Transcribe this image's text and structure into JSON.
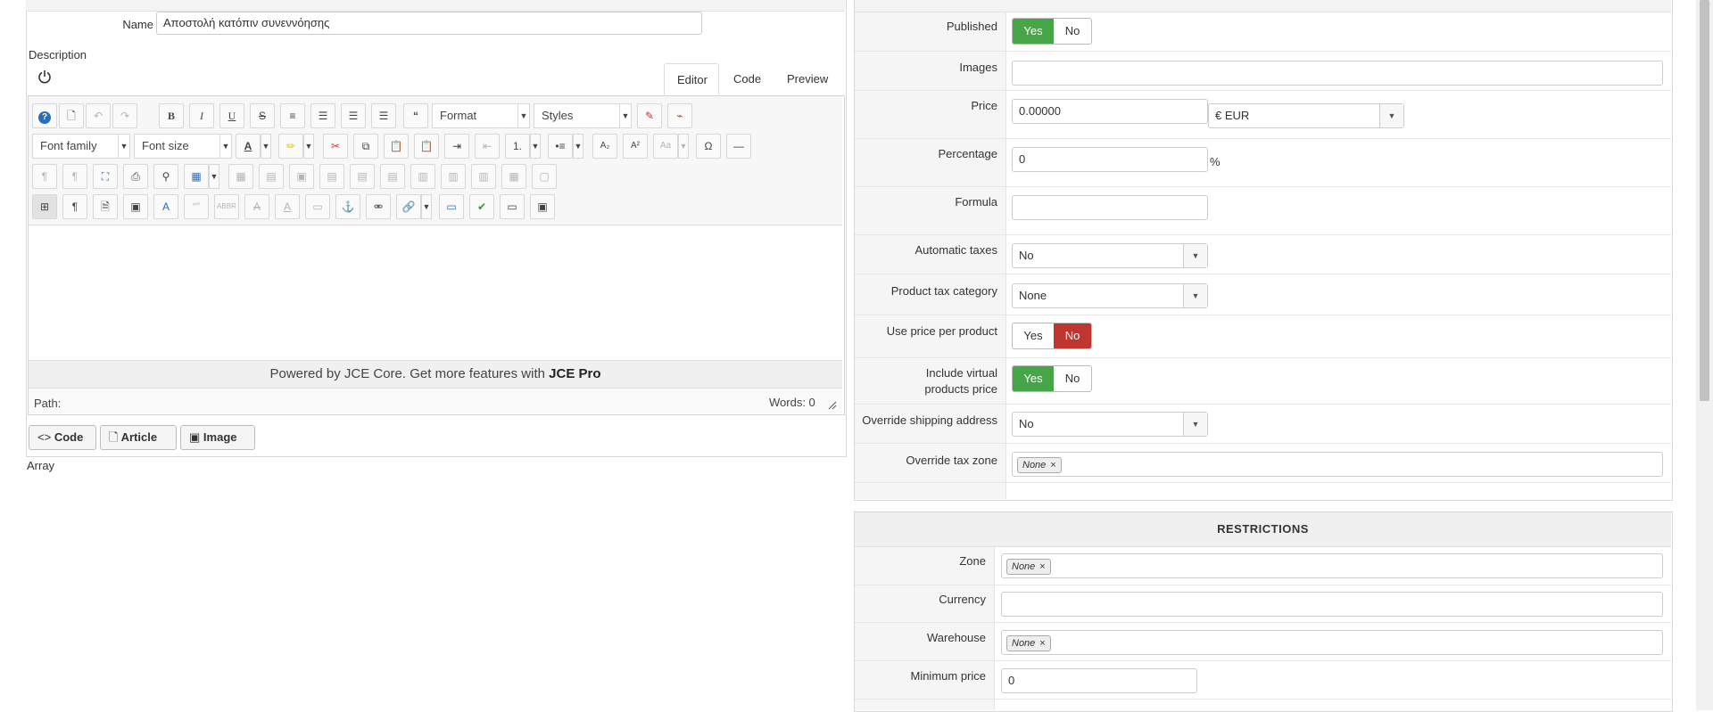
{
  "name_field": {
    "label": "Name",
    "value": "Αποστολή κατόπιν συνεννόησης"
  },
  "description": {
    "label": "Description",
    "tabs": [
      {
        "label": "Editor"
      },
      {
        "label": "Code"
      },
      {
        "label": "Preview"
      }
    ],
    "toolbar": {
      "format_label": "Format",
      "styles_label": "Styles",
      "font_family_label": "Font family",
      "font_size_label": "Font size"
    },
    "powered_by_text": "Powered by JCE Core. Get more features with ",
    "powered_by_strong": "JCE Pro",
    "path_label": "Path:",
    "words_label": "Words: 0",
    "buttons": [
      {
        "label": "Code"
      },
      {
        "label": "Article"
      },
      {
        "label": "Image"
      }
    ]
  },
  "array_text": "Array",
  "pricing": {
    "published": {
      "label": "Published",
      "yes": "Yes",
      "no": "No"
    },
    "images": {
      "label": "Images",
      "value": ""
    },
    "price": {
      "label": "Price",
      "value": "0.00000",
      "currency": "€ EUR"
    },
    "percentage": {
      "label": "Percentage",
      "value": "0",
      "unit": "%"
    },
    "formula": {
      "label": "Formula",
      "value": ""
    },
    "automatic_taxes": {
      "label": "Automatic taxes",
      "value": "No"
    },
    "product_tax_category": {
      "label": "Product tax category",
      "value": "None"
    },
    "use_price_per_product": {
      "label": "Use price per product",
      "yes": "Yes",
      "no": "No"
    },
    "include_virtual": {
      "label_line1": "Include virtual",
      "label_line2": "products price",
      "yes": "Yes",
      "no": "No"
    },
    "override_shipping": {
      "label": "Override shipping address",
      "value": "No"
    },
    "override_tax_zone": {
      "label": "Override tax zone",
      "chip": "None"
    }
  },
  "restrictions": {
    "title": "RESTRICTIONS",
    "zone": {
      "label": "Zone",
      "chip": "None"
    },
    "currency": {
      "label": "Currency",
      "value": ""
    },
    "warehouse": {
      "label": "Warehouse",
      "chip": "None"
    },
    "minimum_price": {
      "label": "Minimum price",
      "value": "0"
    }
  },
  "colors": {
    "yes_green": "#46a546",
    "no_red": "#bd362f"
  }
}
